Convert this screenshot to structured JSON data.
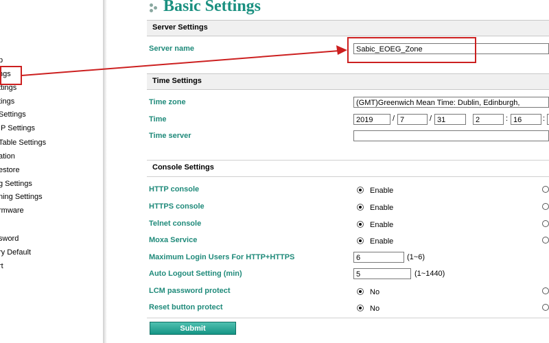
{
  "sidebar": {
    "items": [
      {
        "label": "p"
      },
      {
        "label": "ngs"
      },
      {
        "label": "ttings"
      },
      {
        "label": "tings"
      },
      {
        "label": "Settings"
      },
      {
        "label": "IP Settings"
      },
      {
        "label": "Table Settings"
      },
      {
        "label": "ation"
      },
      {
        "label": "estore"
      },
      {
        "label": "g Settings"
      },
      {
        "label": "ning Settings"
      },
      {
        "label": "rmware"
      },
      {
        "label": ""
      },
      {
        "label": "sword"
      },
      {
        "label": "ry Default"
      },
      {
        "label": "rt"
      }
    ]
  },
  "page": {
    "title": "Basic Settings"
  },
  "server_settings": {
    "header": "Server Settings",
    "server_name_label": "Server name",
    "server_name_value": "Sabic_EOEG_Zone"
  },
  "time_settings": {
    "header": "Time Settings",
    "time_zone_label": "Time zone",
    "time_zone_value": "(GMT)Greenwich Mean Time: Dublin, Edinburgh,",
    "time_label": "Time",
    "year": "2019",
    "month": "7",
    "day": "31",
    "hour": "2",
    "minute": "16",
    "date_sep": "/",
    "time_sep": ":",
    "time_server_label": "Time server",
    "time_server_value": ""
  },
  "console_settings": {
    "header": "Console Settings",
    "rows": [
      {
        "label": "HTTP console",
        "option": "Enable"
      },
      {
        "label": "HTTPS console",
        "option": "Enable"
      },
      {
        "label": "Telnet console",
        "option": "Enable"
      },
      {
        "label": "Moxa Service",
        "option": "Enable"
      }
    ],
    "max_login_label": "Maximum Login Users For HTTP+HTTPS",
    "max_login_value": "6",
    "max_login_hint": "(1~6)",
    "auto_logout_label": "Auto Logout Setting (min)",
    "auto_logout_value": "5",
    "auto_logout_hint": "(1~1440)",
    "lcm_label": "LCM password protect",
    "lcm_option": "No",
    "reset_label": "Reset button protect",
    "reset_option": "No"
  },
  "submit_label": "Submit",
  "colors": {
    "accent": "#1a9080",
    "callout": "#cc1f1f"
  }
}
